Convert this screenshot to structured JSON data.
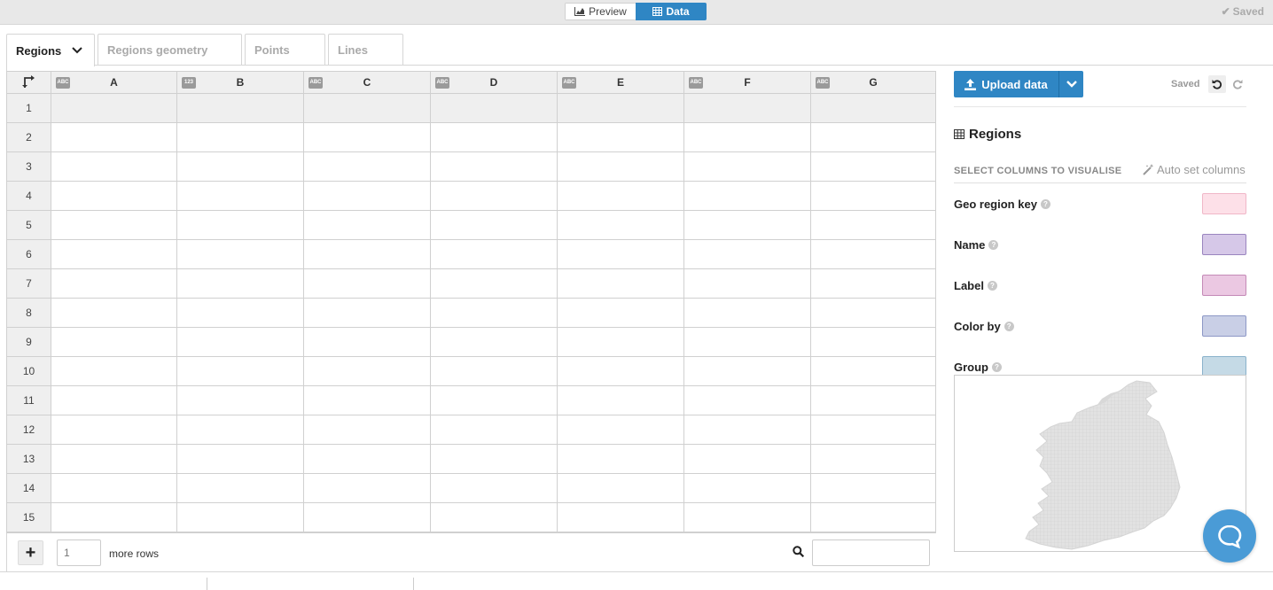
{
  "topbar": {
    "preview_label": "Preview",
    "data_label": "Data",
    "saved_label": "Saved"
  },
  "tabs": [
    {
      "label": "Regions",
      "active": true
    },
    {
      "label": "Regions geometry",
      "active": false
    },
    {
      "label": "Points",
      "active": false
    },
    {
      "label": "Lines",
      "active": false
    }
  ],
  "grid": {
    "columns": [
      {
        "label": "A",
        "type": "ABC"
      },
      {
        "label": "B",
        "type": "123"
      },
      {
        "label": "C",
        "type": "ABC"
      },
      {
        "label": "D",
        "type": "ABC"
      },
      {
        "label": "E",
        "type": "ABC"
      },
      {
        "label": "F",
        "type": "ABC"
      },
      {
        "label": "G",
        "type": "ABC"
      }
    ],
    "rows": [
      "1",
      "2",
      "3",
      "4",
      "5",
      "6",
      "7",
      "8",
      "9",
      "10",
      "11",
      "12",
      "13",
      "14",
      "15"
    ]
  },
  "bottombar": {
    "add_rows_value": "1",
    "more_rows_label": "more rows",
    "search_placeholder": ""
  },
  "sidebar": {
    "upload_label": "Upload data",
    "saved_label": "Saved",
    "section_title": "Regions",
    "select_columns_label": "SELECT COLUMNS TO VISUALISE",
    "auto_set_label": "Auto set columns",
    "bindings": [
      {
        "label": "Geo region key",
        "color": "#fde0e8",
        "border": "#f0b7c8"
      },
      {
        "label": "Name",
        "color": "#d6c8e8",
        "border": "#9a85bf"
      },
      {
        "label": "Label",
        "color": "#ebc8e2",
        "border": "#c48ab7"
      },
      {
        "label": "Color by",
        "color": "#c9cfe6",
        "border": "#8d98c6"
      },
      {
        "label": "Group",
        "color": "#c5dae6",
        "border": "#8ab2cb"
      }
    ]
  },
  "colors": {
    "accent": "#2f86c4",
    "chat": "#4a9bd6"
  }
}
